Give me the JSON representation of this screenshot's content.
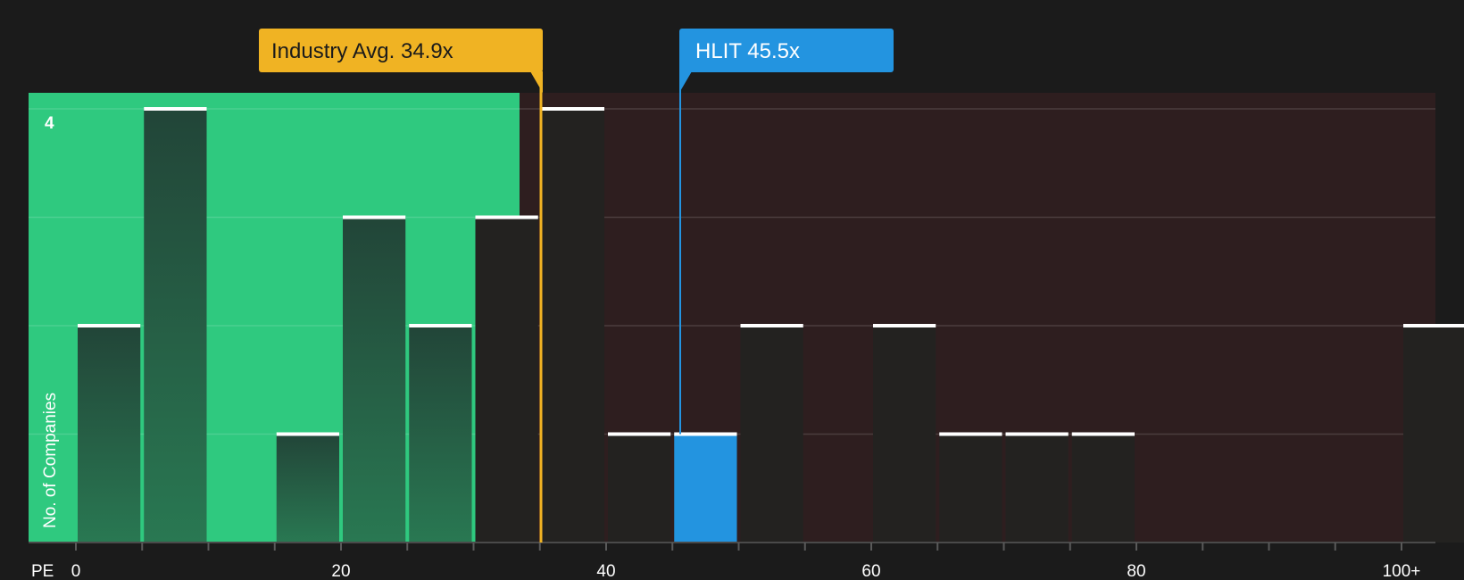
{
  "chart_data": {
    "type": "bar",
    "title": "",
    "xlabel": "PE",
    "ylabel": "No. of Companies",
    "x_ticks": [
      "0",
      "20",
      "40",
      "60",
      "80",
      "100+"
    ],
    "y_tick_label": "4",
    "ylim": [
      0,
      4
    ],
    "xlim": [
      0,
      100
    ],
    "bin_width": 5,
    "bins": [
      {
        "start": 0,
        "value": 2
      },
      {
        "start": 5,
        "value": 4
      },
      {
        "start": 10,
        "value": 0
      },
      {
        "start": 15,
        "value": 1
      },
      {
        "start": 20,
        "value": 3
      },
      {
        "start": 25,
        "value": 2
      },
      {
        "start": 30,
        "value": 3
      },
      {
        "start": 35,
        "value": 4
      },
      {
        "start": 40,
        "value": 1
      },
      {
        "start": 45,
        "value": 1,
        "highlight": true
      },
      {
        "start": 50,
        "value": 2
      },
      {
        "start": 55,
        "value": 0
      },
      {
        "start": 60,
        "value": 2
      },
      {
        "start": 65,
        "value": 1
      },
      {
        "start": 70,
        "value": 1
      },
      {
        "start": 75,
        "value": 1
      },
      {
        "start": 80,
        "value": 0
      },
      {
        "start": 85,
        "value": 0
      },
      {
        "start": 90,
        "value": 0
      },
      {
        "start": 95,
        "value": 0
      },
      {
        "start": 100,
        "value": 2
      }
    ],
    "industry_avg": {
      "label": "Industry Avg. 34.9x",
      "value": 34.9,
      "color": "#f0b323"
    },
    "company": {
      "label": "HLIT 45.5x",
      "value": 45.5,
      "color": "#2394e0"
    },
    "colors": {
      "background": "#1b1b1b",
      "fair_zone": "#2fc97f",
      "overvalued_zone": "#2e1e1f",
      "bar_dark": "#232220",
      "bar_green_top": "#224538",
      "bar_green_bottom": "#297852"
    }
  }
}
